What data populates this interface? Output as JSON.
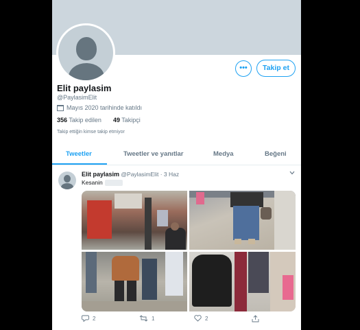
{
  "profile": {
    "name": "Elit paylasim",
    "handle": "@PaylasimElit",
    "joined": "Mayıs 2020 tarihinde katıldı",
    "following_count": "356",
    "following_label": "Takip edilen",
    "followers_count": "49",
    "followers_label": "Takipçi",
    "no_follow_note": "Takip ettiğin kimse takip etmiyor"
  },
  "buttons": {
    "more": "•••",
    "follow": "Takip et"
  },
  "tabs": [
    "Tweetler",
    "Tweetler ve yanıtlar",
    "Medya",
    "Beğeni"
  ],
  "active_tab": "Tweetler",
  "tweet": {
    "name": "Elit paylasim",
    "handle": "@PaylasimElit",
    "separator": "·",
    "date": "3 Haz",
    "text": "Kesanin",
    "reply_count": "2",
    "retweet_count": "1",
    "like_count": "2",
    "media_count": 4
  },
  "icons": {
    "calendar": "calendar-icon",
    "chevron": "chevron-down-icon",
    "reply": "reply-icon",
    "retweet": "retweet-icon",
    "like": "heart-icon",
    "share": "share-icon"
  },
  "colors": {
    "accent": "#1da1f2",
    "banner": "#ccd6dd",
    "muted_text": "#657786",
    "text": "#14171a"
  }
}
